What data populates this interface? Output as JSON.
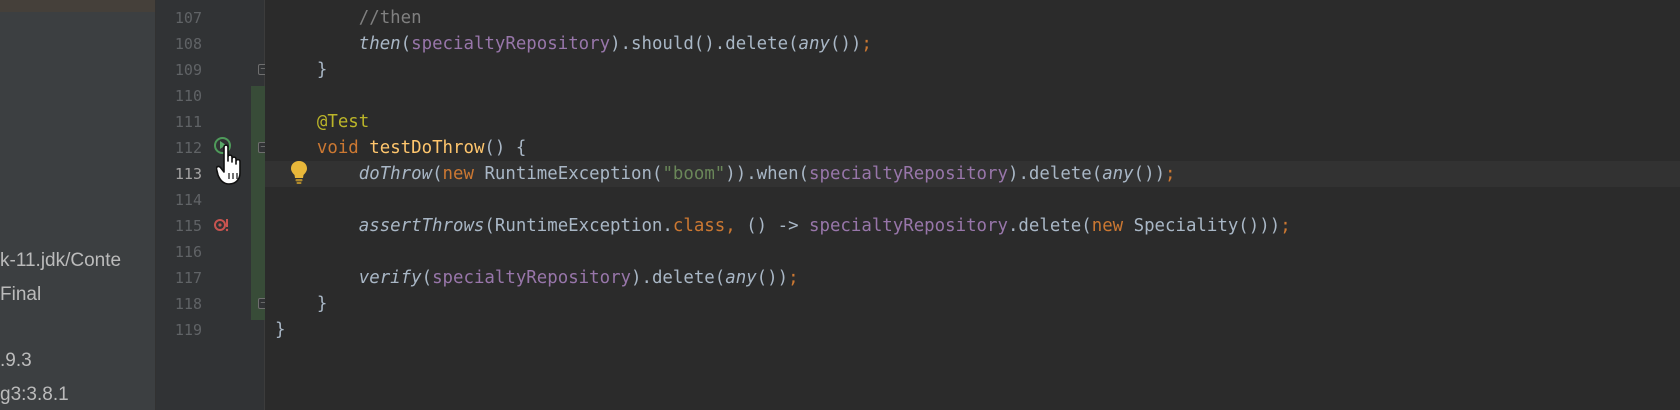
{
  "project_panel": {
    "items": [
      {
        "text": "k-11.jdk/Conte"
      },
      {
        "text": "Final"
      },
      {
        "text": ".9.3"
      },
      {
        "text": "g3:3.8.1"
      }
    ]
  },
  "editor": {
    "current_line": 113,
    "line_numbers": [
      "107",
      "108",
      "109",
      "110",
      "111",
      "112",
      "113",
      "114",
      "115",
      "116",
      "117",
      "118",
      "119"
    ],
    "lines": [
      {
        "number": "107",
        "tokens": [
          {
            "text": "        ",
            "style": "plain"
          },
          {
            "text": "//then",
            "style": "cmt"
          }
        ]
      },
      {
        "number": "108",
        "tokens": [
          {
            "text": "        ",
            "style": "plain"
          },
          {
            "text": "then",
            "style": "it"
          },
          {
            "text": "(",
            "style": "plain"
          },
          {
            "text": "specialtyRepository",
            "style": "field"
          },
          {
            "text": ").should().delete(",
            "style": "plain"
          },
          {
            "text": "any",
            "style": "it"
          },
          {
            "text": "())",
            "style": "plain"
          },
          {
            "text": ";",
            "style": "kw"
          }
        ]
      },
      {
        "number": "109",
        "tokens": [
          {
            "text": "    }",
            "style": "plain"
          }
        ]
      },
      {
        "number": "110",
        "tokens": []
      },
      {
        "number": "111",
        "tokens": [
          {
            "text": "    ",
            "style": "plain"
          },
          {
            "text": "@Test",
            "style": "ann"
          }
        ]
      },
      {
        "number": "112",
        "tokens": [
          {
            "text": "    ",
            "style": "plain"
          },
          {
            "text": "void ",
            "style": "kw"
          },
          {
            "text": "testDoThrow",
            "style": "fn-decl"
          },
          {
            "text": "() {",
            "style": "plain"
          }
        ]
      },
      {
        "number": "113",
        "tokens": [
          {
            "text": "        ",
            "style": "plain"
          },
          {
            "text": "doThrow",
            "style": "it"
          },
          {
            "text": "(",
            "style": "plain"
          },
          {
            "text": "new ",
            "style": "kw"
          },
          {
            "text": "RuntimeException(",
            "style": "plain"
          },
          {
            "text": "\"boom\"",
            "style": "str"
          },
          {
            "text": ")).when(",
            "style": "plain"
          },
          {
            "text": "specialtyRepository",
            "style": "field"
          },
          {
            "text": ").delete(",
            "style": "plain"
          },
          {
            "text": "any",
            "style": "it"
          },
          {
            "text": "())",
            "style": "plain"
          },
          {
            "text": ";",
            "style": "kw"
          }
        ]
      },
      {
        "number": "114",
        "tokens": []
      },
      {
        "number": "115",
        "tokens": [
          {
            "text": "        ",
            "style": "plain"
          },
          {
            "text": "assertThrows",
            "style": "it"
          },
          {
            "text": "(RuntimeException.",
            "style": "plain"
          },
          {
            "text": "class",
            "style": "kw"
          },
          {
            "text": ", ",
            "style": "kw"
          },
          {
            "text": "() -> ",
            "style": "plain"
          },
          {
            "text": "specialtyRepository",
            "style": "field"
          },
          {
            "text": ".delete(",
            "style": "plain"
          },
          {
            "text": "new ",
            "style": "kw"
          },
          {
            "text": "Speciality()))",
            "style": "plain"
          },
          {
            "text": ";",
            "style": "kw"
          }
        ]
      },
      {
        "number": "116",
        "tokens": []
      },
      {
        "number": "117",
        "tokens": [
          {
            "text": "        ",
            "style": "plain"
          },
          {
            "text": "verify",
            "style": "it"
          },
          {
            "text": "(",
            "style": "plain"
          },
          {
            "text": "specialtyRepository",
            "style": "field"
          },
          {
            "text": ").delete(",
            "style": "plain"
          },
          {
            "text": "any",
            "style": "it"
          },
          {
            "text": "())",
            "style": "plain"
          },
          {
            "text": ";",
            "style": "kw"
          }
        ]
      },
      {
        "number": "118",
        "tokens": [
          {
            "text": "    }",
            "style": "plain"
          }
        ]
      },
      {
        "number": "119",
        "tokens": [
          {
            "text": "}",
            "style": "plain"
          }
        ]
      }
    ]
  },
  "gutter_icons": {
    "run_test": "run-test-icon",
    "test_failed": "test-failed-icon",
    "intention_bulb": "lightbulb-icon",
    "mouse_cursor": "hand-cursor-icon"
  },
  "colors": {
    "keyword": "#cc7832",
    "annotation": "#bbb529",
    "field": "#9876aa",
    "string": "#6a8759",
    "method_declaration": "#ffc66d",
    "comment": "#808080",
    "default_text": "#a9b7c6",
    "editor_background": "#2b2b2b"
  }
}
